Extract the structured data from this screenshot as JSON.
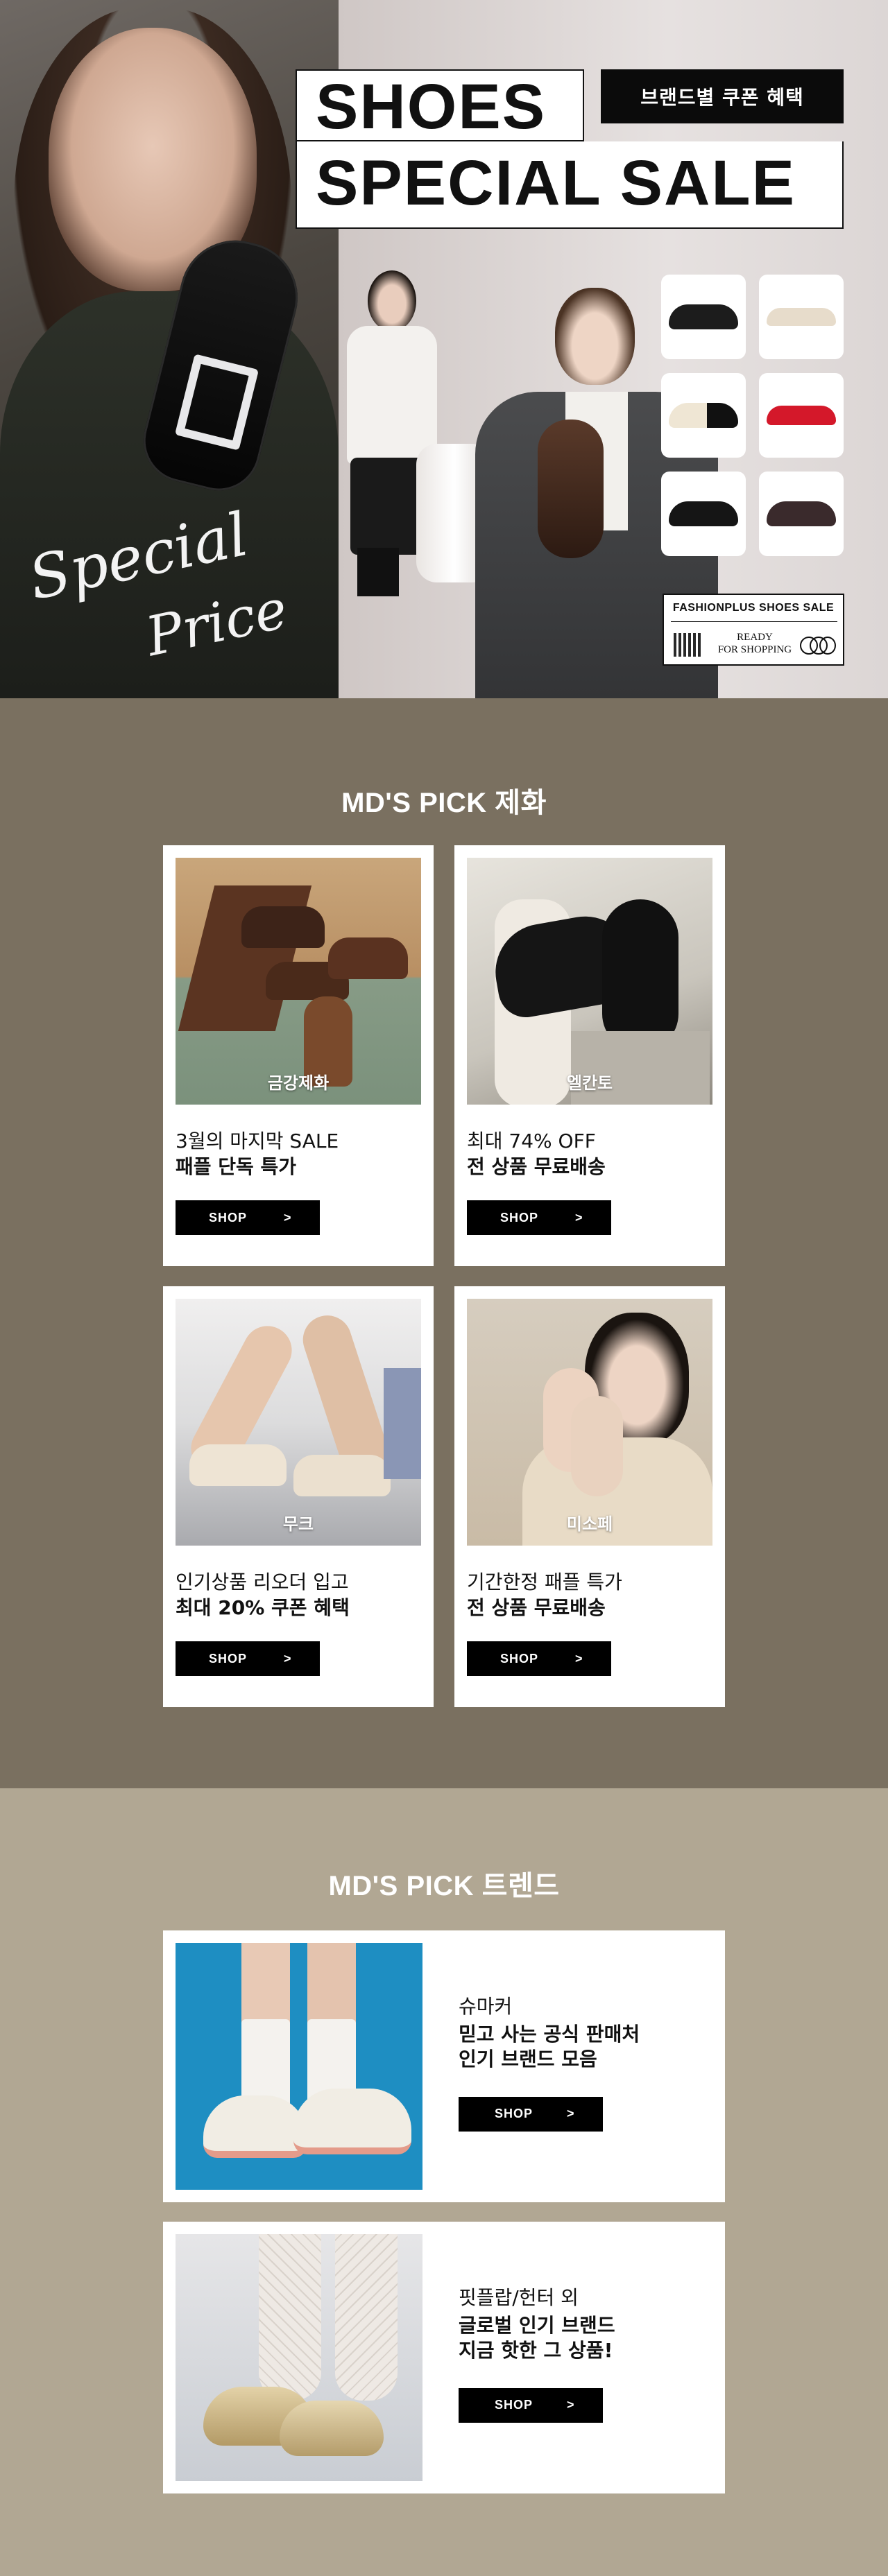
{
  "hero": {
    "title_line1": "SHOES",
    "title_line2": "SPECIAL SALE",
    "coupon_badge": "브랜드별 쿠폰 혜택",
    "script_word1": "Special",
    "script_word2": "Price",
    "stamp_title": "FASHIONPLUS SHOES SALE",
    "stamp_ready": "READY",
    "stamp_for_shopping": "FOR SHOPPING"
  },
  "section_shoes": {
    "title": "MD'S PICK 제화",
    "cards": [
      {
        "brand": "금강제화",
        "line1": "3월의 마지막 SALE",
        "line2": "패플 단독 특가",
        "shop": "SHOP",
        "arrow": ">"
      },
      {
        "brand": "엘칸토",
        "line1": "최대 74% OFF",
        "line2": "전 상품 무료배송",
        "shop": "SHOP",
        "arrow": ">"
      },
      {
        "brand": "무크",
        "line1": "인기상품 리오더 입고",
        "line2": "최대 20% 쿠폰 혜택",
        "shop": "SHOP",
        "arrow": ">"
      },
      {
        "brand": "미소페",
        "line1": "기간한정 패플 특가",
        "line2": "전 상품 무료배송",
        "shop": "SHOP",
        "arrow": ">"
      }
    ]
  },
  "section_trend": {
    "title": "MD'S PICK 트렌드",
    "cards": [
      {
        "brand": "슈마커",
        "line1": "믿고 사는 공식 판매처",
        "line2": "인기 브랜드 모음",
        "shop": "SHOP",
        "arrow": ">"
      },
      {
        "brand": "핏플랍/헌터 외",
        "line1": "글로벌 인기 브랜드",
        "line2": "지금 핫한 그 상품!",
        "shop": "SHOP",
        "arrow": ">"
      }
    ]
  },
  "colors": {
    "section_shoes_bg": "#7a7060",
    "section_trend_bg": "#b1a793",
    "button_bg": "#000000",
    "badge_bg": "#0b0b0b"
  }
}
